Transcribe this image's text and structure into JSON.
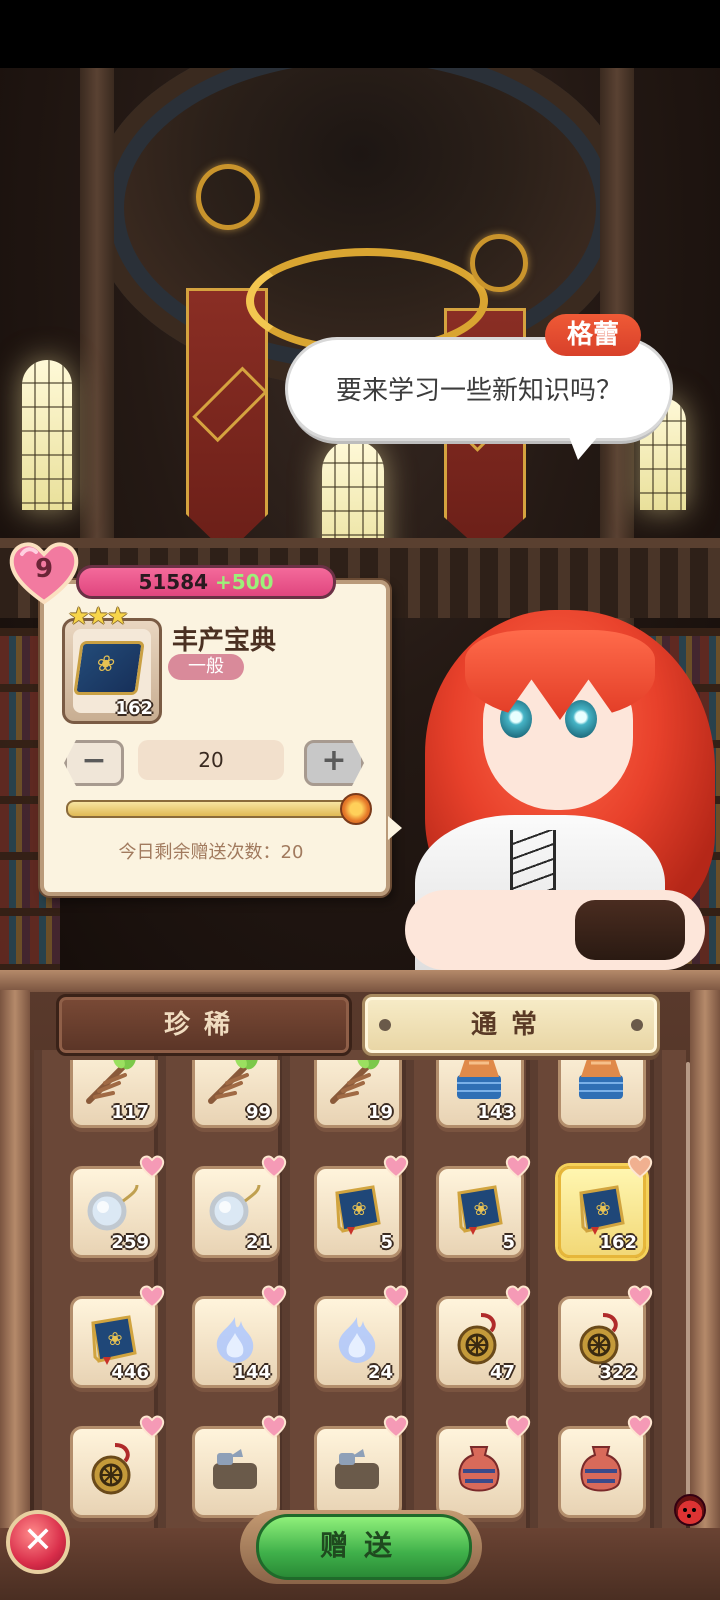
{
  "dialogue": {
    "speaker": "格蕾",
    "text": "要来学习一些新知识吗？"
  },
  "affection": {
    "level": "9",
    "points": "51584",
    "gain": "+500"
  },
  "selected_item": {
    "name": "丰产宝典",
    "rarity": "一般",
    "stars": "★★★",
    "count": "162",
    "icon": "book-icon"
  },
  "quantity": {
    "value": "20",
    "minus_label": "−",
    "plus_label": "+",
    "slider_fraction": 1.0
  },
  "remaining_text": "今日剩余赠送次数：20",
  "tabs": {
    "rare": "珍稀",
    "normal": "通常",
    "active": "normal"
  },
  "inventory": [
    {
      "icon": "branch-icon",
      "count": "117"
    },
    {
      "icon": "branch-icon",
      "count": "99"
    },
    {
      "icon": "branch-icon",
      "count": "19"
    },
    {
      "icon": "cloth-icon",
      "count": "143"
    },
    {
      "icon": "cloth-icon",
      "count": ""
    },
    {
      "icon": "monocle-icon",
      "count": "259"
    },
    {
      "icon": "monocle-icon",
      "count": "21"
    },
    {
      "icon": "book-icon",
      "count": "5"
    },
    {
      "icon": "book-icon",
      "count": "5"
    },
    {
      "icon": "book-icon",
      "count": "162",
      "selected": true
    },
    {
      "icon": "book-icon",
      "count": "446"
    },
    {
      "icon": "spirit-flame-icon",
      "count": "144"
    },
    {
      "icon": "spirit-flame-icon",
      "count": "24"
    },
    {
      "icon": "amulet-icon",
      "count": "47"
    },
    {
      "icon": "amulet-icon",
      "count": "322"
    },
    {
      "icon": "amulet-icon",
      "count": ""
    },
    {
      "icon": "scroll-icon",
      "count": ""
    },
    {
      "icon": "scroll-icon",
      "count": ""
    },
    {
      "icon": "vase-icon",
      "count": ""
    },
    {
      "icon": "vase-icon",
      "count": ""
    }
  ],
  "buttons": {
    "close": "✕",
    "gift": "赠送"
  },
  "colors": {
    "accent_pink": "#e0467f",
    "gift_green": "#3fb04a",
    "speaker_red": "#d8402a"
  }
}
